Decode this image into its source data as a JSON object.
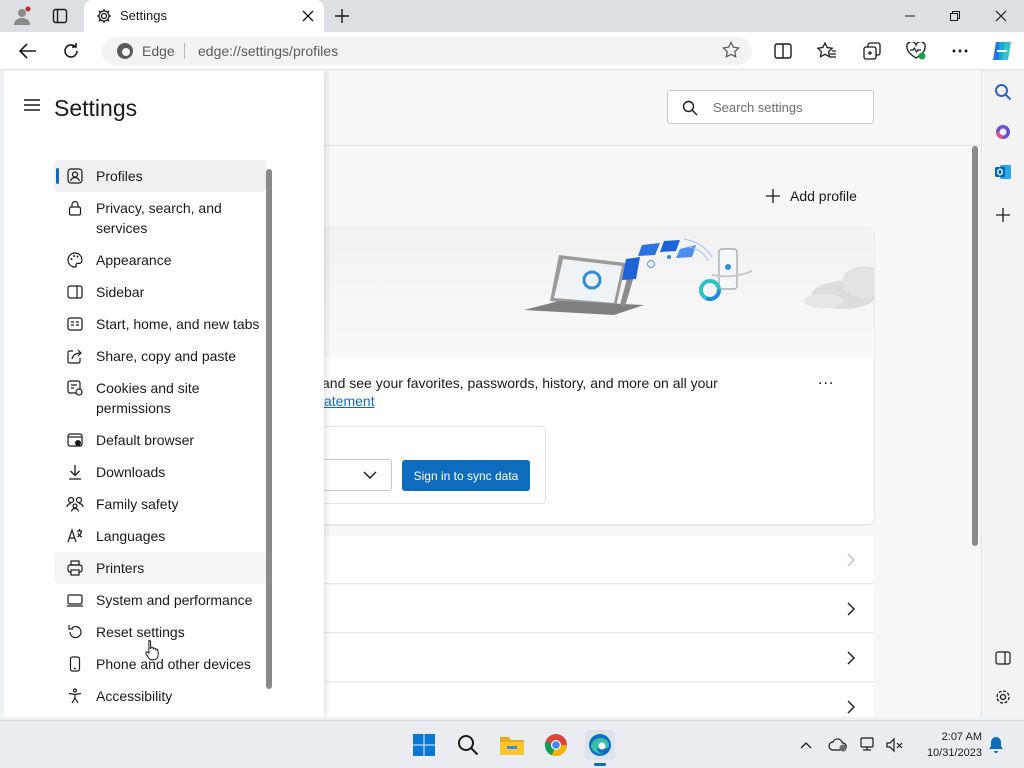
{
  "browser": {
    "tab_title": "Settings",
    "address_brand": "Edge",
    "address_url": "edge://settings/profiles"
  },
  "settings": {
    "heading": "Settings",
    "search_placeholder": "Search settings",
    "nav": [
      {
        "label": "Profiles",
        "icon": "profiles-icon",
        "selected": true
      },
      {
        "label": "Privacy, search, and services",
        "icon": "lock-icon"
      },
      {
        "label": "Appearance",
        "icon": "appearance-icon"
      },
      {
        "label": "Sidebar",
        "icon": "sidebar-icon"
      },
      {
        "label": "Start, home, and new tabs",
        "icon": "home-tabs-icon"
      },
      {
        "label": "Share, copy and paste",
        "icon": "share-icon"
      },
      {
        "label": "Cookies and site permissions",
        "icon": "cookies-icon"
      },
      {
        "label": "Default browser",
        "icon": "default-browser-icon"
      },
      {
        "label": "Downloads",
        "icon": "download-icon"
      },
      {
        "label": "Family safety",
        "icon": "family-icon"
      },
      {
        "label": "Languages",
        "icon": "languages-icon"
      },
      {
        "label": "Printers",
        "icon": "printer-icon",
        "hover": true
      },
      {
        "label": "System and performance",
        "icon": "system-icon"
      },
      {
        "label": "Reset settings",
        "icon": "reset-icon"
      },
      {
        "label": "Phone and other devices",
        "icon": "phone-icon"
      },
      {
        "label": "Accessibility",
        "icon": "accessibility-icon"
      }
    ]
  },
  "profiles": {
    "add_profile": "Add profile",
    "sync_text": "and see your favorites, passwords, history, and more on all your",
    "link_text": "atement",
    "more_label": "...",
    "sign_in_button": "Sign in to sync data"
  },
  "taskbar": {
    "time": "2:07 AM",
    "date": "10/31/2023"
  },
  "colors": {
    "accent": "#0f6cbd",
    "titlebar": "#dcdfe3",
    "taskbar": "#e9edf2"
  }
}
